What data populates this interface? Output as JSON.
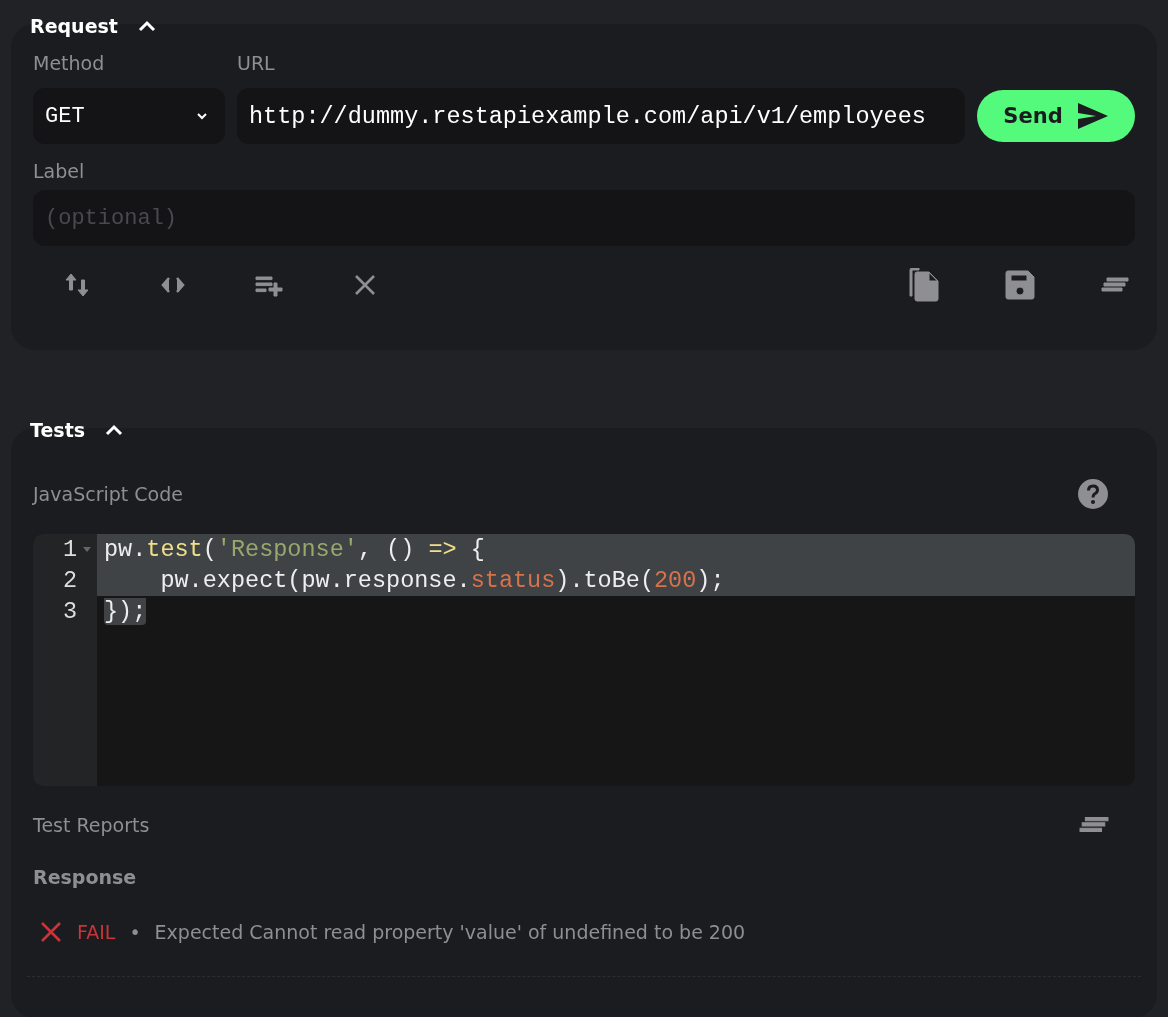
{
  "request": {
    "title": "Request",
    "expanded": true,
    "method": {
      "label": "Method",
      "value": "GET"
    },
    "url": {
      "label": "URL",
      "value": "http://dummy.restapiexample.com/api/v1/employees"
    },
    "send_button": "Send",
    "label_field": {
      "label": "Label",
      "placeholder": "(optional)"
    }
  },
  "tests": {
    "title": "Tests",
    "expanded": true,
    "code_label": "JavaScript Code",
    "code_lines": [
      {
        "number": "1",
        "selected": true,
        "whole_line": true,
        "tokens": [
          {
            "kind": "plain",
            "text": "pw."
          },
          {
            "kind": "fn",
            "text": "test"
          },
          {
            "kind": "plain",
            "text": "("
          },
          {
            "kind": "string",
            "text": "'Response'"
          },
          {
            "kind": "plain",
            "text": ", () "
          },
          {
            "kind": "fn",
            "text": "=>"
          },
          {
            "kind": "plain",
            "text": " {"
          }
        ]
      },
      {
        "number": "2",
        "selected": true,
        "whole_line": true,
        "tokens": [
          {
            "kind": "plain",
            "text": "    pw.expect(pw.response."
          },
          {
            "kind": "num",
            "text": "status"
          },
          {
            "kind": "plain",
            "text": ").toBe("
          },
          {
            "kind": "num",
            "text": "200"
          },
          {
            "kind": "plain",
            "text": ");"
          }
        ]
      },
      {
        "number": "3",
        "selected": true,
        "whole_line": false,
        "tokens": [
          {
            "kind": "plain",
            "text": "});"
          }
        ]
      }
    ],
    "reports_label": "Test Reports",
    "report_group": "Response",
    "results": [
      {
        "passed": false,
        "status_text": "FAIL",
        "separator": "•",
        "message": "Expected Cannot read property 'value' of undefined to be 200"
      }
    ]
  }
}
